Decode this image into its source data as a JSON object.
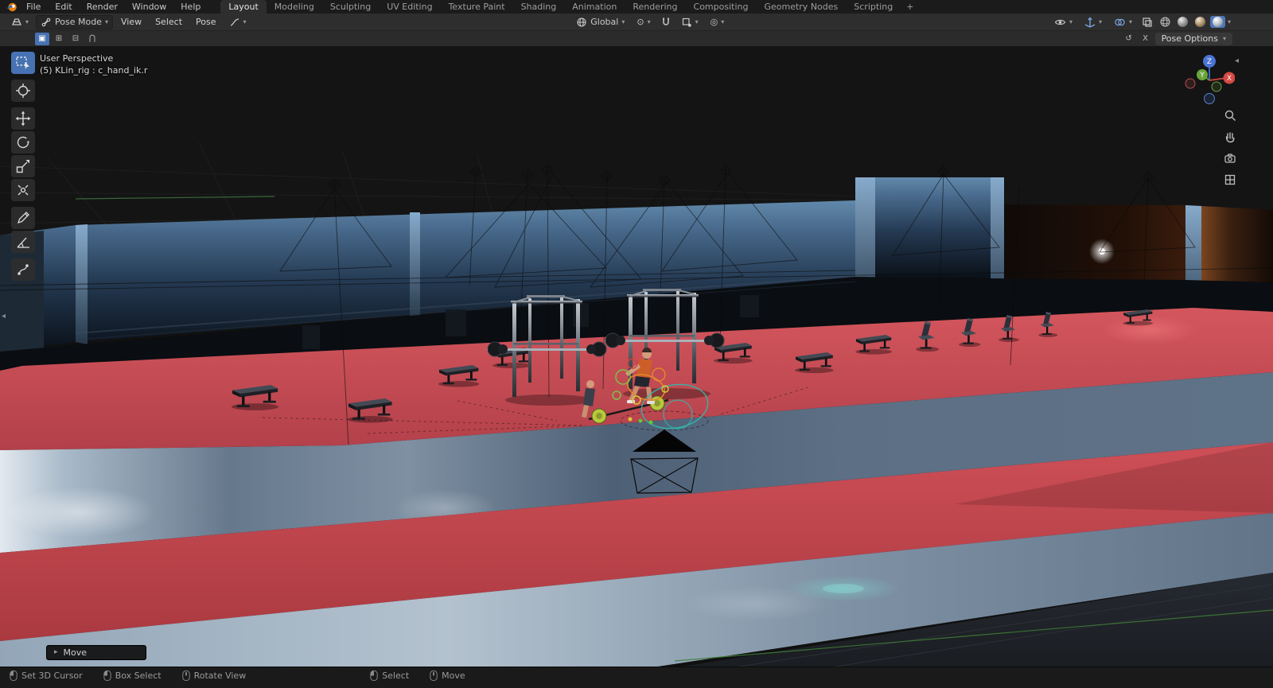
{
  "colors": {
    "accent": "#4772b3",
    "floor_red": "#c4484f",
    "wall_blue": "#4a7096"
  },
  "icons": {
    "chevron": "▾",
    "pivot": "⊙",
    "proportional": "◎",
    "mode_set": "▣",
    "mode_extend": "⊞",
    "mode_subtract": "⊟",
    "mode_intersect": "⋂",
    "arrow_right": "▸",
    "collapse_left": "◂",
    "mirror": "↺",
    "close": "×"
  },
  "menubar": {
    "menus": [
      "File",
      "Edit",
      "Render",
      "Window",
      "Help"
    ],
    "workspaces": [
      "Layout",
      "Modeling",
      "Sculpting",
      "UV Editing",
      "Texture Paint",
      "Shading",
      "Animation",
      "Rendering",
      "Compositing",
      "Geometry Nodes",
      "Scripting"
    ],
    "add_tab": "+"
  },
  "viewport_header": {
    "mode": "Pose Mode",
    "menus": [
      "View",
      "Select",
      "Pose"
    ],
    "orientation": "Global"
  },
  "tool_settings": {
    "mirror_axis": "X",
    "pose_options": "Pose Options"
  },
  "viewport": {
    "perspective": "User Perspective",
    "active_item": "(5) KLin_rig : c_hand_ik.r",
    "operator": "Move"
  },
  "gizmo_axes": {
    "x": "X",
    "y": "Y",
    "z": "Z"
  },
  "toolbar_tools": [
    "select-box",
    "cursor",
    "move",
    "rotate",
    "scale",
    "transform",
    "annotate",
    "measure",
    "pose-breakdowner"
  ],
  "statusbar": {
    "items": [
      "Set 3D Cursor",
      "Box Select",
      "Rotate View",
      "Select",
      "Move"
    ]
  }
}
